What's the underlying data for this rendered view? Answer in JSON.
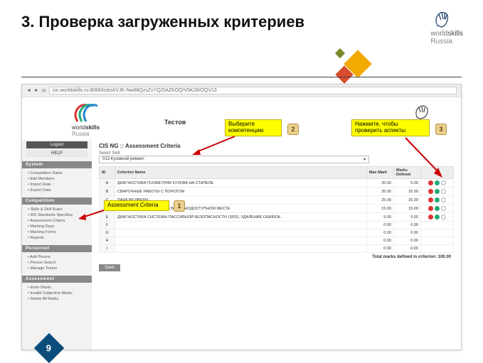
{
  "slide": {
    "title": "3. Проверка загруженных критериев",
    "page_number": "9",
    "brand": {
      "name": "worldskills",
      "sub": "Russia"
    }
  },
  "callouts": {
    "c1": "Assessment Criteria",
    "c2": "Выберите компетенцию",
    "c3": "Нажмите, чтобы проверить аспекты",
    "b1": "1",
    "b2": "2",
    "b3": "3"
  },
  "browser": {
    "url": "cis.worldskills.ru:8086/tctest/VJK-Nw88QzsZvYQZtAZKOQ/V0K26/OQV13"
  },
  "page": {
    "page_title": "Тестов",
    "heading": "CIS NG :: Assessment Criteria",
    "select_label": "Select Skill",
    "select_value": "013 Кузовной ремонт",
    "save": "Save",
    "total_label": "Total marks defined in criterion: 100.00"
  },
  "sidebar": {
    "logout": "Logout",
    "help": "HELP",
    "groups": [
      {
        "h": "System",
        "items": [
          "Competition Dates",
          "Edit Members",
          "Import Data",
          "Export Data"
        ]
      },
      {
        "h": "Competition",
        "items": [
          "Skills & Skill Rules",
          "WS Standards Specifica",
          "Assessment Criteria",
          "Marking Days",
          "Marking Forms",
          "Reports"
        ]
      },
      {
        "h": "Personnel",
        "items": [
          "Add Person",
          "Person Search",
          "Manage Teams"
        ]
      },
      {
        "h": "Assessment",
        "items": [
          "Enter Marks",
          "Invalid Subjective Marks",
          "Delete All Marks"
        ]
      }
    ]
  },
  "table": {
    "headers": {
      "id": "ID",
      "name": "Criterion Name",
      "max": "Max Mark",
      "defined": "Marks Defined"
    },
    "rows": [
      {
        "id": "A",
        "name": "ДИАГНОСТИКА ГЕОМЕТРИИ КУЗОВА НА СТАПЕЛЕ",
        "max": "20.00",
        "def": "5.00",
        "act": true
      },
      {
        "id": "B",
        "name": "СВАРОЧНЫЕ РАБОТЫ С ПОРОГОМ",
        "max": "35.00",
        "def": "25.00",
        "act": true
      },
      {
        "id": "C",
        "name": "ПАНЕЛИ ДВЕРИ",
        "max": "25.00",
        "def": "25.00",
        "act": true
      },
      {
        "id": "D",
        "name": "РИХТОВКА ПАНЕЛИ ДВЕРИ В ТРУДНОДОСТУПНОМ МЕСТЕ",
        "max": "15.00",
        "def": "15.00",
        "act": true
      },
      {
        "id": "E",
        "name": "ДИАГНОСТИКА СИСТЕМЫ ПАССИВНОЙ БЕЗОПАСНОСТИ (SRS). УДАЛЕНИЕ ОШИБОК.",
        "max": "5.00",
        "def": "5.00",
        "act": true
      },
      {
        "id": "F",
        "name": "",
        "max": "0.00",
        "def": "0.00",
        "act": false
      },
      {
        "id": "G",
        "name": "",
        "max": "0.00",
        "def": "0.00",
        "act": false
      },
      {
        "id": "H",
        "name": "",
        "max": "0.00",
        "def": "0.00",
        "act": false
      },
      {
        "id": "I",
        "name": "",
        "max": "0.00",
        "def": "0.00",
        "act": false
      }
    ]
  }
}
